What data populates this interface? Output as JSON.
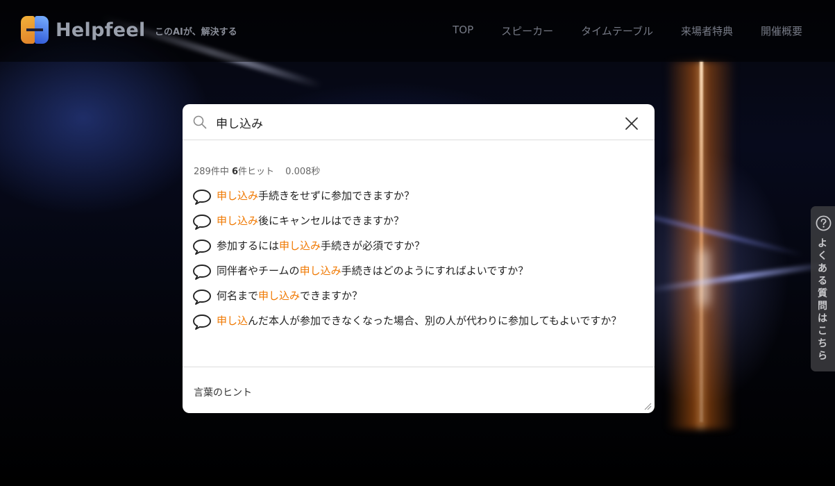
{
  "header": {
    "logo_text": "Helpfeel",
    "tagline": "このAIが、解決する",
    "nav": [
      "TOP",
      "スピーカー",
      "タイムテーブル",
      "来場者特典",
      "開催概要"
    ]
  },
  "search": {
    "query": "申し込み",
    "stats": {
      "total": "289件中",
      "hits": "6",
      "hits_suffix": "件ヒット",
      "time": "0.008秒"
    },
    "results": [
      {
        "highlight": "申し込み",
        "pre": "",
        "post": "手続きをせずに参加できますか？"
      },
      {
        "highlight": "申し込み",
        "pre": "",
        "post": "後にキャンセルはできますか？"
      },
      {
        "pre": "参加するには",
        "highlight": "申し込み",
        "post": "手続きが必須ですか？"
      },
      {
        "pre": "同伴者やチームの",
        "highlight": "申し込み",
        "post": "手続きはどのようにすればよいですか？"
      },
      {
        "pre": "何名まで",
        "highlight": "申し込み",
        "post": "できますか？"
      },
      {
        "pre": "",
        "highlight": "申し込",
        "post": "んだ本人が参加できなくなった場合、別の人が代わりに参加してもよいですか？"
      }
    ],
    "hint_label": "言葉のヒント"
  },
  "faq_tab": {
    "label": "よくある質問はこちら"
  },
  "colors": {
    "highlight": "#f07800",
    "logo_orange": "#e0822a",
    "logo_blue": "#2f58d8"
  }
}
